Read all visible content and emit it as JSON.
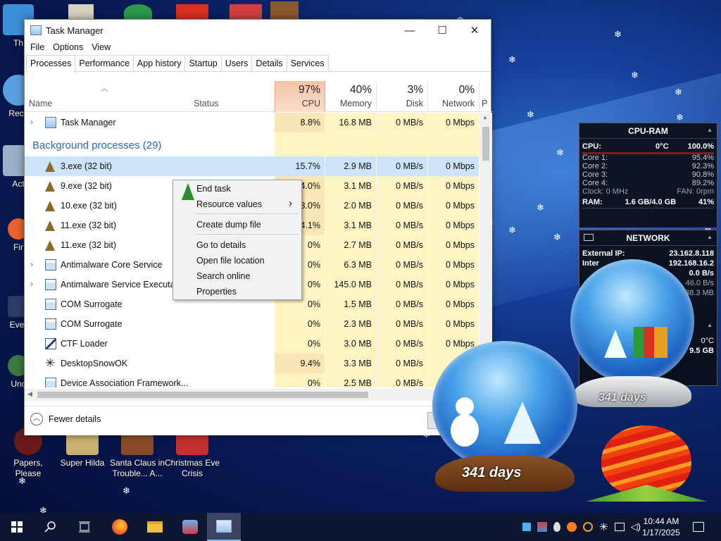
{
  "desktop": {
    "icons": [
      {
        "label": "Th",
        "color": "#3a8fd8"
      },
      {
        "label": "Recy",
        "color": "#5aa0e0"
      },
      {
        "label": "Act",
        "color": "#9ab0c8"
      },
      {
        "label": "Fir",
        "color": "#e8632a"
      },
      {
        "label": "Ever",
        "color": "#2a3d66"
      },
      {
        "label": "Unc",
        "color": "#3a7a3a"
      },
      {
        "label": "Papers, Please",
        "color": "#6a1a1a"
      },
      {
        "label": "Super Hilda",
        "color": "#c8b070"
      },
      {
        "label": "Santa Claus in Trouble... A...",
        "color": "#8a4a2a"
      },
      {
        "label": "Christmas Eve Crisis",
        "color": "#c43030"
      }
    ]
  },
  "taskmanager": {
    "title": "Task Manager",
    "window_buttons": {
      "minimize": "—",
      "maximize": "☐",
      "close": "✕"
    },
    "menu": [
      "File",
      "Options",
      "View"
    ],
    "tabs": [
      "Processes",
      "Performance",
      "App history",
      "Startup",
      "Users",
      "Details",
      "Services"
    ],
    "active_tab": "Processes",
    "columns": {
      "name": "Name",
      "status": "Status",
      "cpu": {
        "pct": "97%",
        "label": "CPU"
      },
      "memory": {
        "pct": "40%",
        "label": "Memory"
      },
      "disk": {
        "pct": "3%",
        "label": "Disk"
      },
      "network": {
        "pct": "0%",
        "label": "Network"
      },
      "power": "P"
    },
    "apps": [
      {
        "name": "Task Manager",
        "cpu": "8.8%",
        "mem": "16.8 MB",
        "disk": "0 MB/s",
        "net": "0 Mbps",
        "expand": true
      }
    ],
    "group_title": "Background processes (29)",
    "processes": [
      {
        "name": "3.exe (32 bit)",
        "cpu": "15.7%",
        "mem": "2.9 MB",
        "disk": "0 MB/s",
        "net": "0 Mbps",
        "icon": "tree",
        "selected": true
      },
      {
        "name": "9.exe (32 bit)",
        "cpu": "4.0%",
        "mem": "3.1 MB",
        "disk": "0 MB/s",
        "net": "0 Mbps",
        "icon": "tree"
      },
      {
        "name": "10.exe (32 bit)",
        "cpu": "3.0%",
        "mem": "2.0 MB",
        "disk": "0 MB/s",
        "net": "0 Mbps",
        "icon": "tree"
      },
      {
        "name": "11.exe (32 bit)",
        "cpu": "4.1%",
        "mem": "3.1 MB",
        "disk": "0 MB/s",
        "net": "0 Mbps",
        "icon": "tree"
      },
      {
        "name": "11.exe (32 bit)",
        "cpu": "0%",
        "mem": "2.7 MB",
        "disk": "0 MB/s",
        "net": "0 Mbps",
        "icon": "tree"
      },
      {
        "name": "Antimalware Core Service",
        "cpu": "0%",
        "mem": "6.3 MB",
        "disk": "0 MB/s",
        "net": "0 Mbps",
        "icon": "service",
        "expand": true
      },
      {
        "name": "Antimalware Service Executable",
        "cpu": "0%",
        "mem": "145.0 MB",
        "disk": "0 MB/s",
        "net": "0 Mbps",
        "icon": "service",
        "expand": true
      },
      {
        "name": "COM Surrogate",
        "cpu": "0%",
        "mem": "1.5 MB",
        "disk": "0 MB/s",
        "net": "0 Mbps",
        "icon": "service"
      },
      {
        "name": "COM Surrogate",
        "cpu": "0%",
        "mem": "2.3 MB",
        "disk": "0 MB/s",
        "net": "0 Mbps",
        "icon": "service"
      },
      {
        "name": "CTF Loader",
        "cpu": "0%",
        "mem": "3.0 MB",
        "disk": "0 MB/s",
        "net": "0 Mbps",
        "icon": "pen"
      },
      {
        "name": "DesktopSnowOK",
        "cpu": "9.4%",
        "mem": "3.3 MB",
        "disk": "0 MB/s",
        "net": "0",
        "icon": "snowflake"
      },
      {
        "name": "Device Association Framework...",
        "cpu": "0%",
        "mem": "2.5 MB",
        "disk": "0 MB/s",
        "net": "0",
        "icon": "service"
      }
    ],
    "fewer_details": "Fewer details"
  },
  "context_menu": {
    "items": [
      "End task",
      "Resource values",
      "Create dump file",
      "Go to details",
      "Open file location",
      "Search online",
      "Properties"
    ],
    "submenu_arrow": "›"
  },
  "cpu_ram_gadget": {
    "title": "CPU-RAM",
    "cpu_label": "CPU:",
    "temp": "0°C",
    "total": "100.0%",
    "cores": [
      {
        "label": "Core 1:",
        "value": "95.4%"
      },
      {
        "label": "Core 2:",
        "value": "92.3%"
      },
      {
        "label": "Core 3:",
        "value": "90.8%"
      },
      {
        "label": "Core 4:",
        "value": "89.2%"
      }
    ],
    "clock": "Clock: 0 MHz",
    "fan": "FAN: 0rpm",
    "ram_label": "RAM:",
    "ram_value": "1.6 GB/4.0 GB",
    "ram_pct": "41%"
  },
  "network_gadget": {
    "title": "NETWORK",
    "external_ip_label": "External IP:",
    "external_ip": "23.162.8.118",
    "internal_label": "Inter",
    "internal_ip": "192.168.16.2",
    "speed1": "0.0 B/s",
    "speed2": "46.0 B/s",
    "speed3": "38.3 MB",
    "temp2": "0°C",
    "size2": "9.5 GB"
  },
  "globes": {
    "left_days": "341 days",
    "right_days": "341 days"
  },
  "taskbar": {
    "time": "10:44 AM",
    "date": "1/17/2025"
  }
}
